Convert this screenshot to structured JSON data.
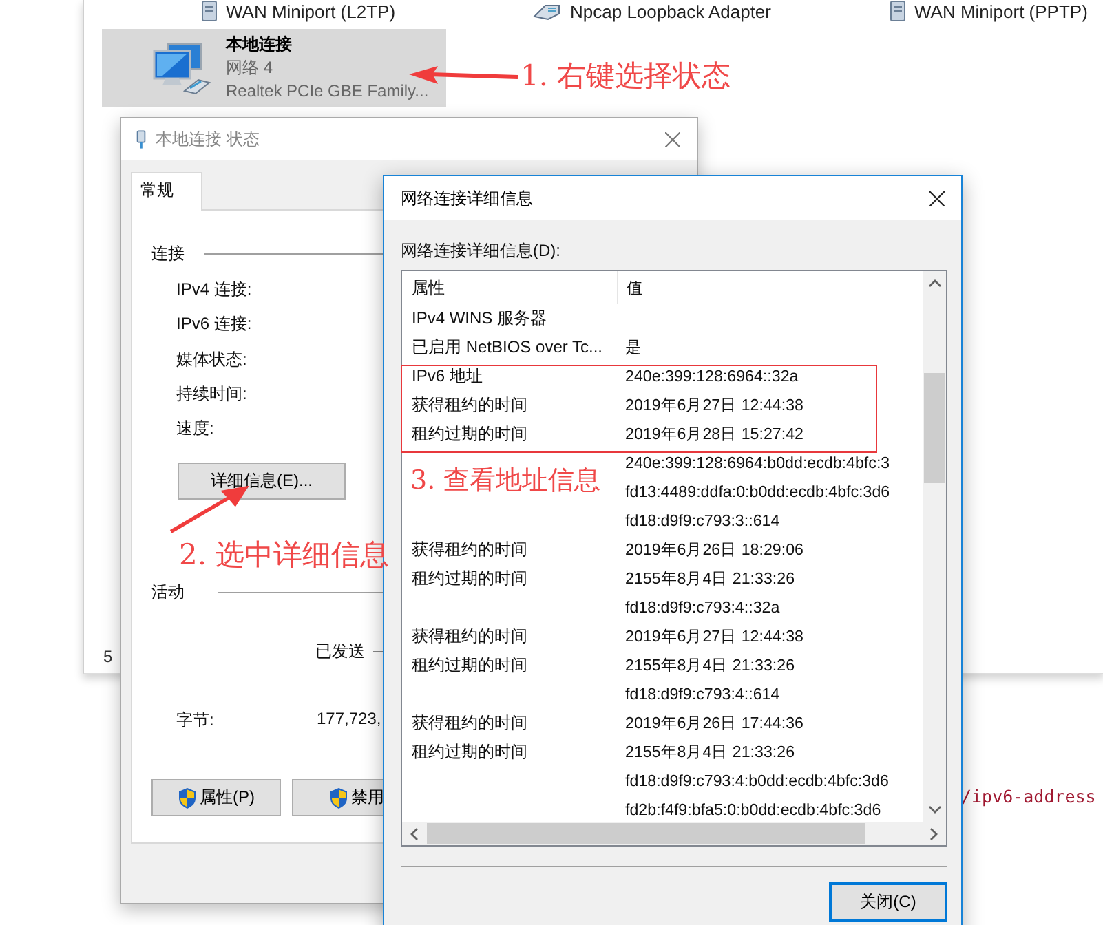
{
  "explorer": {
    "adapters": [
      {
        "name": "WAN Miniport (L2TP)",
        "kind": "server",
        "selected": false
      },
      {
        "name": "Npcap Loopback Adapter",
        "kind": "plug",
        "selected": false
      },
      {
        "name": "WAN Miniport (PPTP)",
        "kind": "server",
        "selected": false
      },
      {
        "name": "本地连接",
        "network": "网络 4",
        "device": "Realtek PCIe GBE Family...",
        "kind": "monitor",
        "selected": true
      }
    ],
    "status_bar": "5"
  },
  "background_code": "/ipv6-address",
  "status_dialog": {
    "title": "本地连接 状态",
    "tabs": [
      {
        "label": "常规",
        "selected": true
      }
    ],
    "connection_group": "连接",
    "fields": [
      "IPv4 连接:",
      "IPv6 连接:",
      "媒体状态:",
      "持续时间:",
      "速度:"
    ],
    "details_button": "详细信息(E)...",
    "activity_group": "活动",
    "sent_label": "已发送",
    "bytes_label": "字节:",
    "bytes_sent": "177,723,",
    "buttons": [
      "属性(P)",
      "禁用"
    ]
  },
  "details_dialog": {
    "title": "网络连接详细信息",
    "list_label": "网络连接详细信息(D):",
    "columns": [
      "属性",
      "值"
    ],
    "rows": [
      {
        "property": "IPv4 WINS 服务器"
      },
      {
        "property": "已启用 NetBIOS over Tc...",
        "value": "是"
      },
      {
        "property": "IPv6 地址",
        "value": "240e:399:128:6964::32a"
      },
      {
        "property": "获得租约的时间",
        "value": "2019年6月27日 12:44:38"
      },
      {
        "property": "租约过期的时间",
        "value": "2019年6月28日 15:27:42"
      },
      {
        "value": "240e:399:128:6964:b0dd:ecdb:4bfc:3"
      },
      {
        "value": "fd13:4489:ddfa:0:b0dd:ecdb:4bfc:3d6"
      },
      {
        "value": "fd18:d9f9:c793:3::614"
      },
      {
        "property": "获得租约的时间",
        "value": "2019年6月26日 18:29:06"
      },
      {
        "property": "租约过期的时间",
        "value": "2155年8月4日 21:33:26"
      },
      {
        "value": "fd18:d9f9:c793:4::32a"
      },
      {
        "property": "获得租约的时间",
        "value": "2019年6月27日 12:44:38"
      },
      {
        "property": "租约过期的时间",
        "value": "2155年8月4日 21:33:26"
      },
      {
        "value": "fd18:d9f9:c793:4::614"
      },
      {
        "property": "获得租约的时间",
        "value": "2019年6月26日 17:44:36"
      },
      {
        "property": "租约过期的时间",
        "value": "2155年8月4日 21:33:26"
      },
      {
        "value": "fd18:d9f9:c793:4:b0dd:ecdb:4bfc:3d6"
      },
      {
        "value": "fd2b:f4f9:bfa5:0:b0dd:ecdb:4bfc:3d6"
      }
    ],
    "close_button": "关闭(C)"
  },
  "annotations": [
    {
      "text": "1.  右键选择状态"
    },
    {
      "text": "2.  选中详细信息"
    },
    {
      "text": "3.  查看地址信息"
    }
  ]
}
